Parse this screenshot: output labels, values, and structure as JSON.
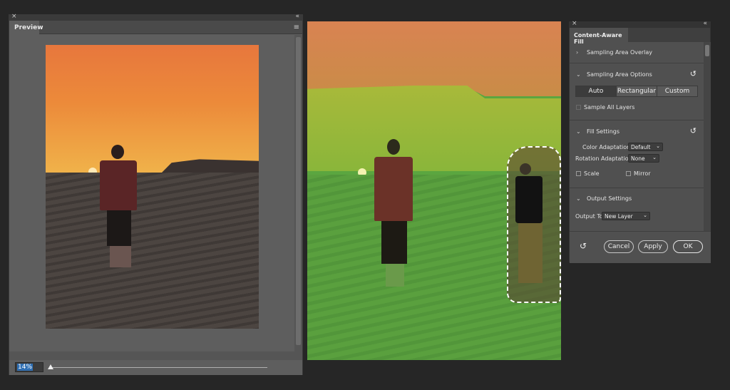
{
  "preview_panel": {
    "tab_label": "Preview",
    "close_glyph": "×",
    "collapse_glyph": "«",
    "menu_icon": "hamburger-menu-icon",
    "zoom_value": "14%"
  },
  "content_aware_fill": {
    "tab_label": "Content-Aware Fill",
    "close_glyph": "×",
    "collapse_glyph": "«",
    "sections": {
      "sampling_overlay": {
        "label": "Sampling Area Overlay",
        "expanded": false
      },
      "sampling_options": {
        "label": "Sampling Area Options",
        "expanded": true,
        "modes": [
          "Auto",
          "Rectangular",
          "Custom"
        ],
        "selected_mode": "Auto",
        "sample_all_layers": "Sample All Layers"
      },
      "fill_settings": {
        "label": "Fill Settings",
        "expanded": true,
        "color_adaptation_label": "Color Adaptation",
        "color_adaptation_value": "Default",
        "rotation_adaptation_label": "Rotation Adaptation",
        "rotation_adaptation_value": "None",
        "scale_label": "Scale",
        "mirror_label": "Mirror"
      },
      "output_settings": {
        "label": "Output Settings",
        "expanded": true,
        "output_to_label": "Output To",
        "output_to_value": "New Layer"
      }
    },
    "buttons": {
      "cancel": "Cancel",
      "apply": "Apply",
      "ok": "OK"
    }
  },
  "colors": {
    "sampling_overlay_green": "#5ba640",
    "sky_orange": "#ec8a3a",
    "panel_gray": "#505050",
    "background": "#262626"
  }
}
